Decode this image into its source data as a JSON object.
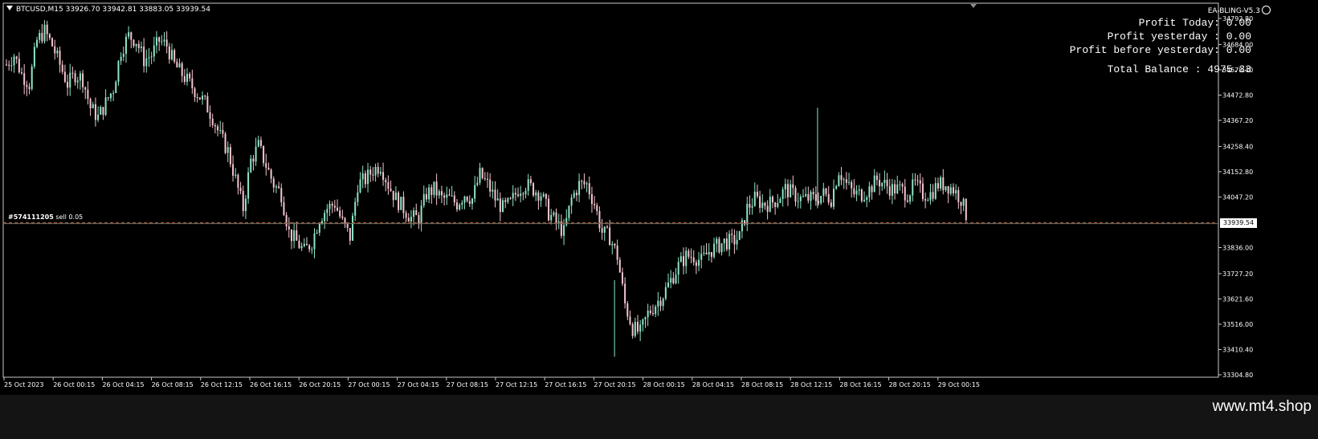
{
  "chart": {
    "symbol_line": "BTCUSD,M15  33926.70 33942.81 33883.05 33939.54",
    "ea_name": "EA-BLING-V5.3",
    "order_label_id": "#574111205",
    "order_label_rest": " sell 0.05",
    "current_price": "33939.54",
    "price_line_value": 33939.54,
    "price_range": [
      33304.8,
      34792.8
    ],
    "price_ticks": [
      "34792.80",
      "34684.00",
      "34578.40",
      "34472.80",
      "34367.20",
      "34258.40",
      "34152.80",
      "34047.20",
      "33939.54",
      "33836.00",
      "33727.20",
      "33621.60",
      "33516.00",
      "33410.40",
      "33304.80"
    ],
    "time_labels": [
      "25 Oct 2023",
      "26 Oct 00:15",
      "26 Oct 04:15",
      "26 Oct 08:15",
      "26 Oct 12:15",
      "26 Oct 16:15",
      "26 Oct 20:15",
      "27 Oct 00:15",
      "27 Oct 04:15",
      "27 Oct 08:15",
      "27 Oct 12:15",
      "27 Oct 16:15",
      "27 Oct 20:15",
      "28 Oct 00:15",
      "28 Oct 04:15",
      "28 Oct 08:15",
      "28 Oct 12:15",
      "28 Oct 16:15",
      "28 Oct 20:15",
      "29 Oct 00:15"
    ],
    "colors": {
      "background": "#000000",
      "bull": "#8ee6c6",
      "bear": "#f5c6cf",
      "price_line": "#c46a2f",
      "frame": "#c8c8c8"
    },
    "close_path": [
      34600,
      34640,
      34560,
      34520,
      34700,
      34740,
      34680,
      34600,
      34520,
      34560,
      34540,
      34420,
      34380,
      34440,
      34500,
      34660,
      34720,
      34700,
      34620,
      34640,
      34700,
      34680,
      34600,
      34560,
      34520,
      34480,
      34440,
      34380,
      34300,
      34240,
      34120,
      34000,
      34200,
      34260,
      34180,
      34100,
      34060,
      33900,
      33860,
      33820,
      33860,
      33960,
      34000,
      34020,
      33940,
      33880,
      34100,
      34120,
      34160,
      34180,
      34100,
      34040,
      34000,
      33960,
      33960,
      34060,
      34080,
      34040,
      34040,
      34020,
      34060,
      34040,
      34140,
      34100,
      34040,
      34000,
      34020,
      34080,
      34100,
      34080,
      34060,
      33980,
      33940,
      33900,
      34040,
      34100,
      34100,
      34020,
      33900,
      33880,
      33800,
      33600,
      33500,
      33480,
      33560,
      33600,
      33640,
      33700,
      33760,
      33800,
      33800,
      33780,
      33820,
      33840,
      33860,
      33860,
      33880,
      34000,
      34040,
      34020,
      34020,
      34040,
      34080,
      34060,
      34040,
      34040,
      34040,
      34060,
      34040,
      34160,
      34100,
      34060,
      34060,
      34080,
      34120,
      34100,
      34080,
      34080,
      34060,
      34100,
      34060,
      34060,
      34100,
      34100,
      34080,
      34040,
      33940
    ],
    "price_panel": {
      "profit_today": "Profit Today: 0.00",
      "profit_yesterday": "Profit yesterday : 0.00",
      "profit_before_yesterday": "Profit before yesterday: 0.00",
      "total_balance": "Total Balance : 4975.33"
    }
  },
  "watermark": "www.mt4.shop"
}
